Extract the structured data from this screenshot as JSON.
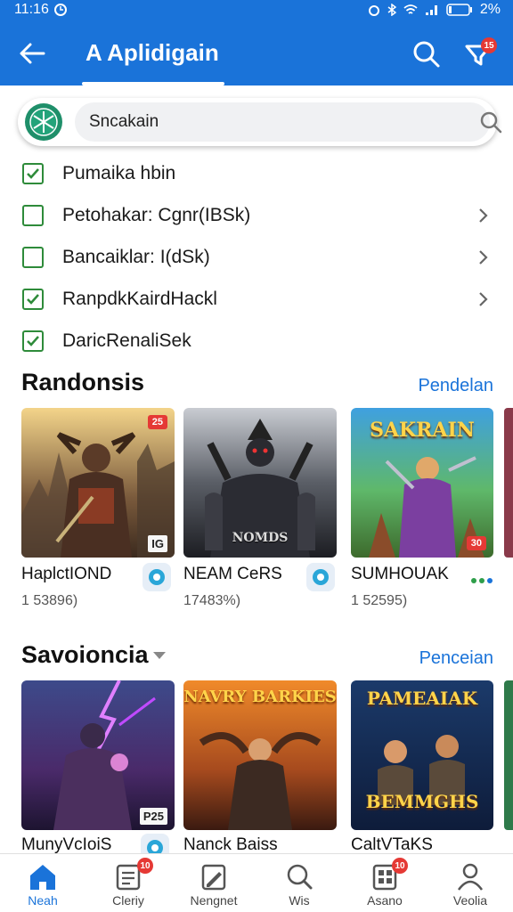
{
  "status_bar": {
    "time": "11:16",
    "battery": "2%"
  },
  "app_bar": {
    "title": "A Aplidigain",
    "filter_badge": "15",
    "accent": "#1a73d9"
  },
  "search": {
    "value": "Sncakain"
  },
  "checklist": [
    {
      "label": "Pumaika hbin",
      "checked": true,
      "chevron": false
    },
    {
      "label": "Petohakar: Cgnr(IBSk)",
      "checked": false,
      "chevron": true
    },
    {
      "label": "Bancaiklar: I(dSk)",
      "checked": false,
      "chevron": true
    },
    {
      "label": "RanpdkKairdHackl",
      "checked": true,
      "chevron": true
    },
    {
      "label": "DaricRenaliSek",
      "checked": true,
      "chevron": false
    }
  ],
  "section1": {
    "title": "Randonsis",
    "link": "Pendelan",
    "cards": [
      {
        "name": "HaplctIOND",
        "sub": "1 53896)",
        "top_badge": "25",
        "corner": "IG"
      },
      {
        "name": "NEAM CeRS",
        "sub": "17483%)",
        "art_caption": "NOMDS"
      },
      {
        "name": "SUMHOUAK",
        "sub": "1 52595)",
        "top_badge": "30",
        "art_title": "SAKRAIN"
      }
    ]
  },
  "section2": {
    "title": "Savoioncia",
    "link": "Penceian",
    "cards": [
      {
        "name": "MunyVcIoiS",
        "corner": "P25"
      },
      {
        "name": "Nanck Baiss",
        "art_title": "NAVRY BARKIES"
      },
      {
        "name": "CaltVTaKS",
        "art_title": "PAMEAIAK",
        "art_title2": "BEMMGHS"
      }
    ]
  },
  "bottom_nav": [
    {
      "label": "Neah",
      "icon": "home-icon"
    },
    {
      "label": "Cleriy",
      "icon": "list-icon",
      "badge": "10"
    },
    {
      "label": "Nengnet",
      "icon": "edit-icon"
    },
    {
      "label": "Wis",
      "icon": "search-icon"
    },
    {
      "label": "Asano",
      "icon": "grid-icon",
      "badge": "10"
    },
    {
      "label": "Veolia",
      "icon": "person-icon"
    }
  ]
}
